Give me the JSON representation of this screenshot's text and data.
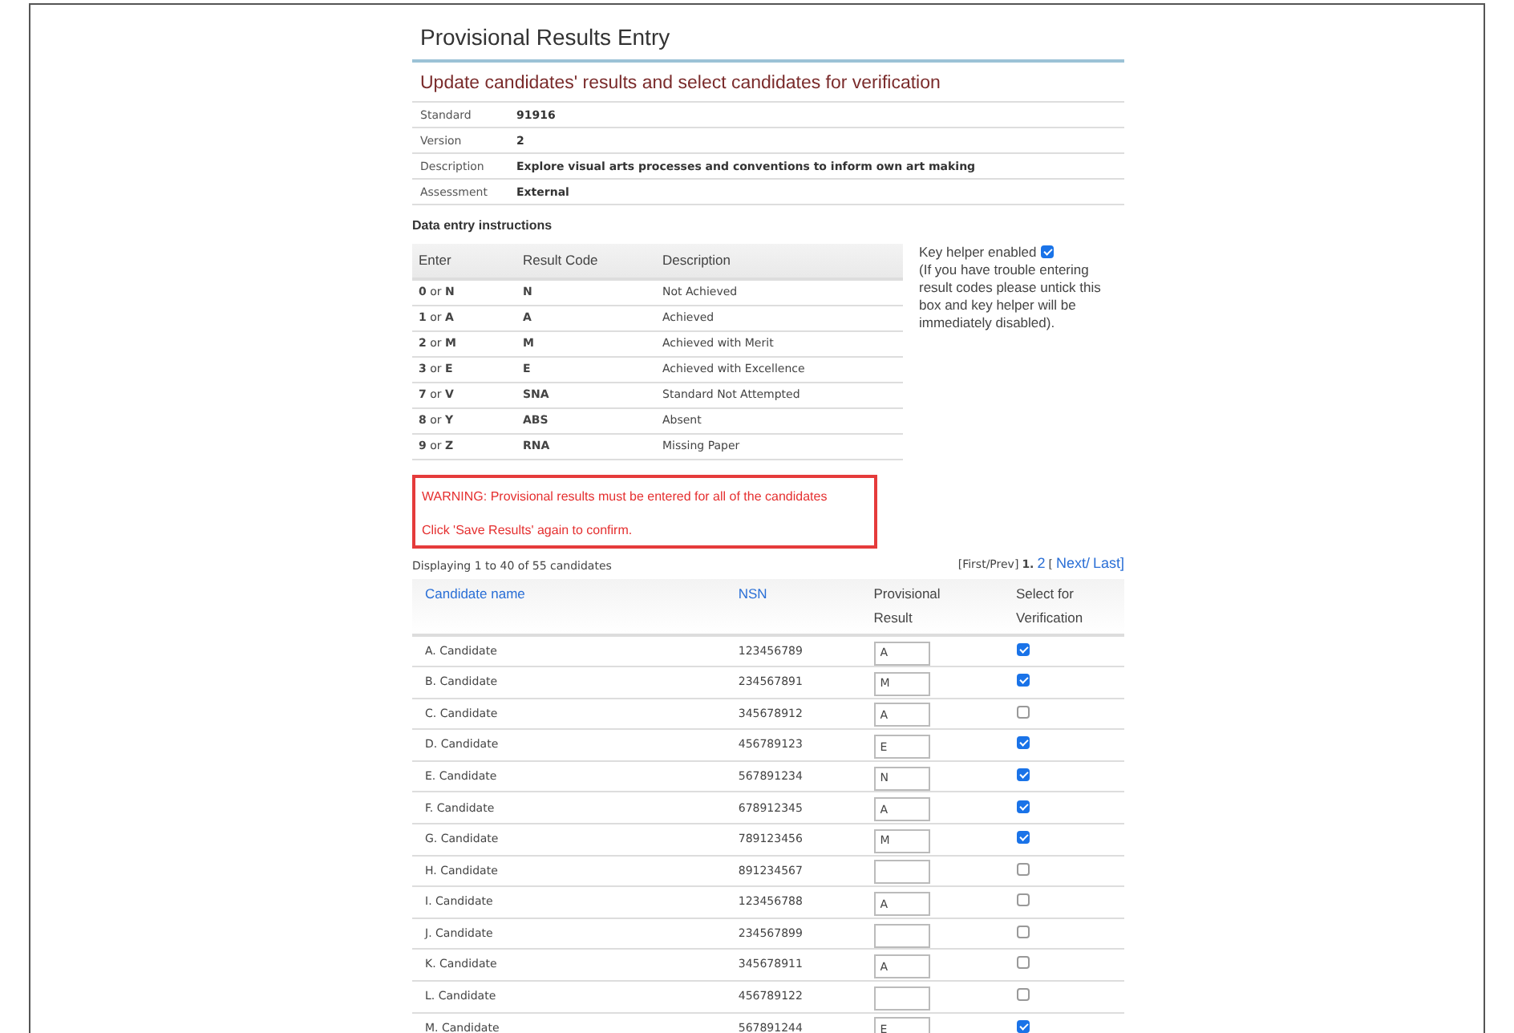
{
  "title": "Provisional Results Entry",
  "subtitle": "Update candidates' results and select candidates for verification",
  "details": [
    {
      "label": "Standard",
      "value": "91916"
    },
    {
      "label": "Version",
      "value": "2"
    },
    {
      "label": "Description",
      "value": "Explore visual arts processes and conventions to inform own art making"
    },
    {
      "label": "Assessment",
      "value": "External"
    }
  ],
  "instructions": {
    "heading": "Data entry instructions",
    "columns": [
      "Enter",
      "Result Code",
      "Description"
    ],
    "rows": [
      {
        "enter": "**0** or **N**",
        "code": "N",
        "description": "Not Achieved"
      },
      {
        "enter": "**1** or **A**",
        "code": "A",
        "description": "Achieved"
      },
      {
        "enter": "**2** or **M**",
        "code": "M",
        "description": "Achieved with Merit"
      },
      {
        "enter": "**3** or **E**",
        "code": "E",
        "description": "Achieved with Excellence"
      },
      {
        "enter": "**7** or **V**",
        "code": "SNA",
        "description": "Standard Not Attempted"
      },
      {
        "enter": "**8** or **Y**",
        "code": "ABS",
        "description": "Absent"
      },
      {
        "enter": "**9** or **Z**",
        "code": "RNA",
        "description": "Missing Paper"
      }
    ]
  },
  "key_helper": {
    "label": "Key helper enabled",
    "checked": true,
    "note": "(If you have trouble entering result codes please untick this box and key helper will be immediately disabled)."
  },
  "warning": {
    "lines": [
      "WARNING: Provisional results must be entered for all of the candidates",
      "Click 'Save Results' again to confirm."
    ]
  },
  "displaying": "Displaying 1 to 40 of 55 candidates",
  "pagination": [
    {
      "kind": "text",
      "text": "[First/Prev]"
    },
    {
      "kind": "current",
      "text": "1."
    },
    {
      "kind": "link",
      "text": "2"
    },
    {
      "kind": "text",
      "text": "["
    },
    {
      "kind": "link",
      "text": "Next/"
    },
    {
      "kind": "link",
      "text": "Last]"
    }
  ],
  "candidates": {
    "columns": [
      {
        "label": "Candidate name",
        "sortable": true
      },
      {
        "label": "NSN",
        "sortable": true
      },
      {
        "label": "Provisional Result",
        "sortable": false
      },
      {
        "label": "Select for Verification",
        "sortable": false
      }
    ],
    "rows": [
      {
        "name": "A. Candidate",
        "nsn": "123456789",
        "result": "A",
        "selected": true
      },
      {
        "name": "B. Candidate",
        "nsn": "234567891",
        "result": "M",
        "selected": true
      },
      {
        "name": "C. Candidate",
        "nsn": "345678912",
        "result": "A",
        "selected": false
      },
      {
        "name": "D. Candidate",
        "nsn": "456789123",
        "result": "E",
        "selected": true
      },
      {
        "name": "E. Candidate",
        "nsn": "567891234",
        "result": "N",
        "selected": true
      },
      {
        "name": "F. Candidate",
        "nsn": "678912345",
        "result": "A",
        "selected": true
      },
      {
        "name": "G. Candidate",
        "nsn": "789123456",
        "result": "M",
        "selected": true
      },
      {
        "name": "H. Candidate",
        "nsn": "891234567",
        "result": "",
        "selected": false
      },
      {
        "name": "I. Candidate",
        "nsn": "123456788",
        "result": "A",
        "selected": false
      },
      {
        "name": "J. Candidate",
        "nsn": "234567899",
        "result": "",
        "selected": false
      },
      {
        "name": "K. Candidate",
        "nsn": "345678911",
        "result": "A",
        "selected": false
      },
      {
        "name": "L. Candidate",
        "nsn": "456789122",
        "result": "",
        "selected": false
      },
      {
        "name": "M. Candidate",
        "nsn": "567891244",
        "result": "E",
        "selected": true
      }
    ]
  }
}
